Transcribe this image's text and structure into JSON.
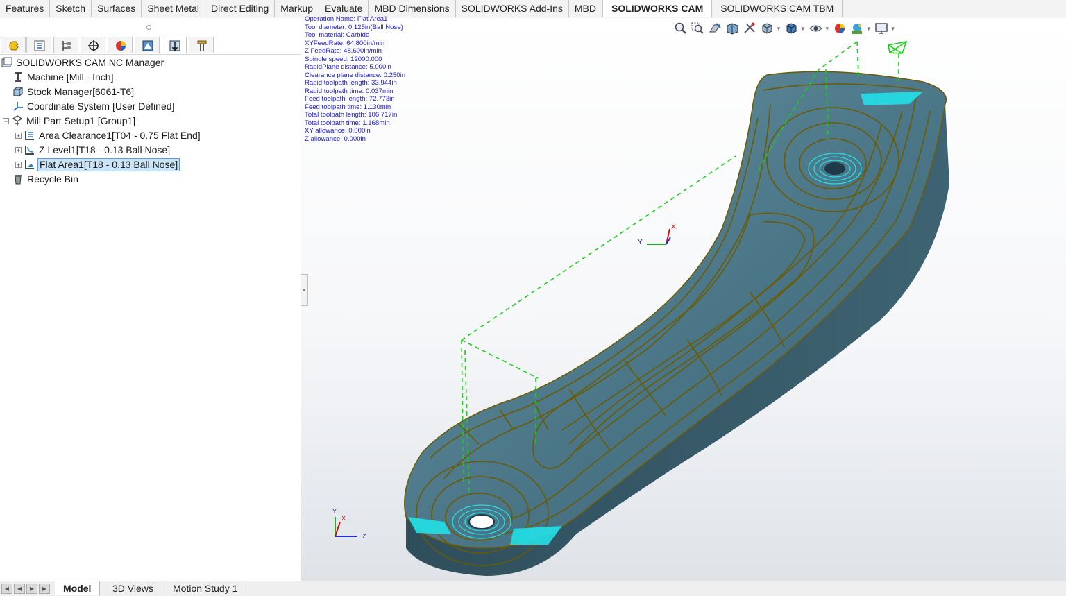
{
  "tabs": [
    "Features",
    "Sketch",
    "Surfaces",
    "Sheet Metal",
    "Direct Editing",
    "Markup",
    "Evaluate",
    "MBD Dimensions",
    "SOLIDWORKS Add-Ins",
    "MBD",
    "SOLIDWORKS CAM",
    "SOLIDWORKS CAM TBM"
  ],
  "active_tab": "SOLIDWORKS CAM",
  "manager_tabs": [
    "featuremanager-icon",
    "propertymanager-icon",
    "configurationmanager-icon",
    "dimxpert-icon",
    "display-manager-icon",
    "cam-feature-tree-icon",
    "cam-operation-tree-icon",
    "cam-tools-tree-icon"
  ],
  "tree": {
    "root": "SOLIDWORKS CAM NC Manager",
    "machine": "Machine [Mill - Inch]",
    "stock": "Stock Manager[6061-T6]",
    "coord": "Coordinate System [User Defined]",
    "setup": "Mill Part Setup1 [Group1]",
    "ops": [
      "Area Clearance1[T04 - 0.75 Flat End]",
      "Z Level1[T18 - 0.13 Ball Nose]",
      "Flat Area1[T18 - 0.13 Ball Nose]"
    ],
    "recycle": "Recycle Bin"
  },
  "info_lines": [
    "Operation Name: Flat Area1",
    "Tool diameter: 0.125in(Ball Nose)",
    "Tool material: Carbide",
    "XYFeedRate: 64.800in/min",
    "Z FeedRate: 48.600in/min",
    "Spindle speed: 12000.000",
    "RapidPlane distance: 5.000in",
    "Clearance plane distance: 0.250in",
    "Rapid toolpath length: 33.944in",
    "Rapid toolpath time: 0.037min",
    "Feed toolpath length: 72.773in",
    "Feed toolpath time: 1.130min",
    "Total toolpath length: 106.717in",
    "Total toolpath time: 1.168min",
    "XY allowance: 0.000in",
    "Z allowance: 0.000in"
  ],
  "triad_main": {
    "x": "X",
    "y": "Y"
  },
  "triad_corner": {
    "x": "X",
    "y": "Y",
    "z": "Z"
  },
  "bottom_tabs": [
    "Model",
    "3D Views",
    "Motion Study 1"
  ],
  "hud_icons": [
    "zoom-to-fit-icon",
    "zoom-to-area-icon",
    "previous-view-icon",
    "section-view-icon",
    "dynamic-annotation-icon",
    "view-orientation-icon",
    "display-style-icon",
    "hide-show-icon",
    "edit-appearance-icon",
    "apply-scene-icon",
    "view-settings-icon"
  ],
  "colors": {
    "part": "#3f6b7c",
    "toolpath": "#6b5a00",
    "rapid": "#18d018",
    "cut": "#22e0e8",
    "info": "#1b1bd8",
    "selection": "#cce4f7"
  }
}
